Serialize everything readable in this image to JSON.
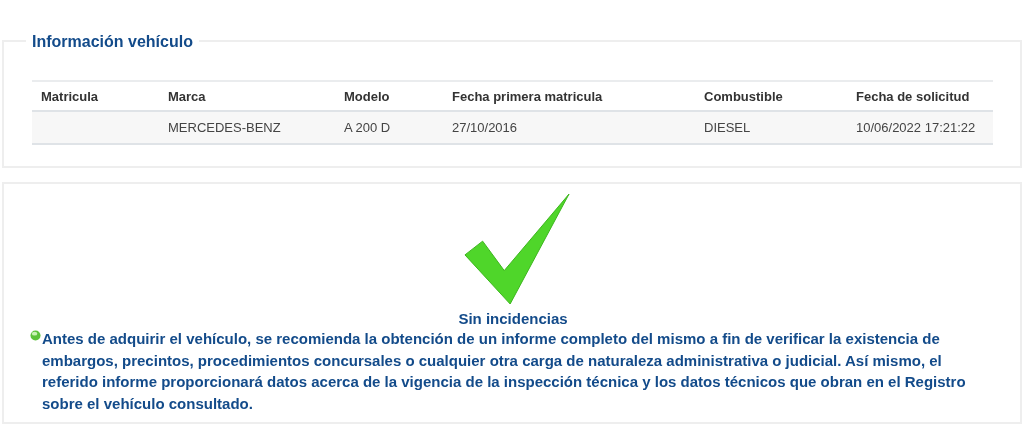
{
  "vehicle_info": {
    "title": "Información vehículo",
    "table": {
      "columns": [
        "Matricula",
        "Marca",
        "Modelo",
        "Fecha primera matricula",
        "Combustible",
        "Fecha de solicitud"
      ],
      "rows": [
        {
          "cells": [
            "",
            "MERCEDES-BENZ",
            "A 200 D",
            "27/10/2016",
            "DIESEL",
            "10/06/2022 17:21:22"
          ]
        }
      ]
    }
  },
  "result": {
    "passed": true,
    "title": "Sin incidencias",
    "message": "Antes de adquirir el vehículo, se recomienda la obtención de un informe completo del mismo a fin de verificar la existencia de embargos, precintos, procedimientos concursales o cualquier otra carga de naturaleza administrativa o judicial. Así mismo, el referido informe proporcionará datos acerca de la vigencia de la inspección técnica y los datos técnicos que obran en el Registro sobre el vehículo consultado."
  }
}
